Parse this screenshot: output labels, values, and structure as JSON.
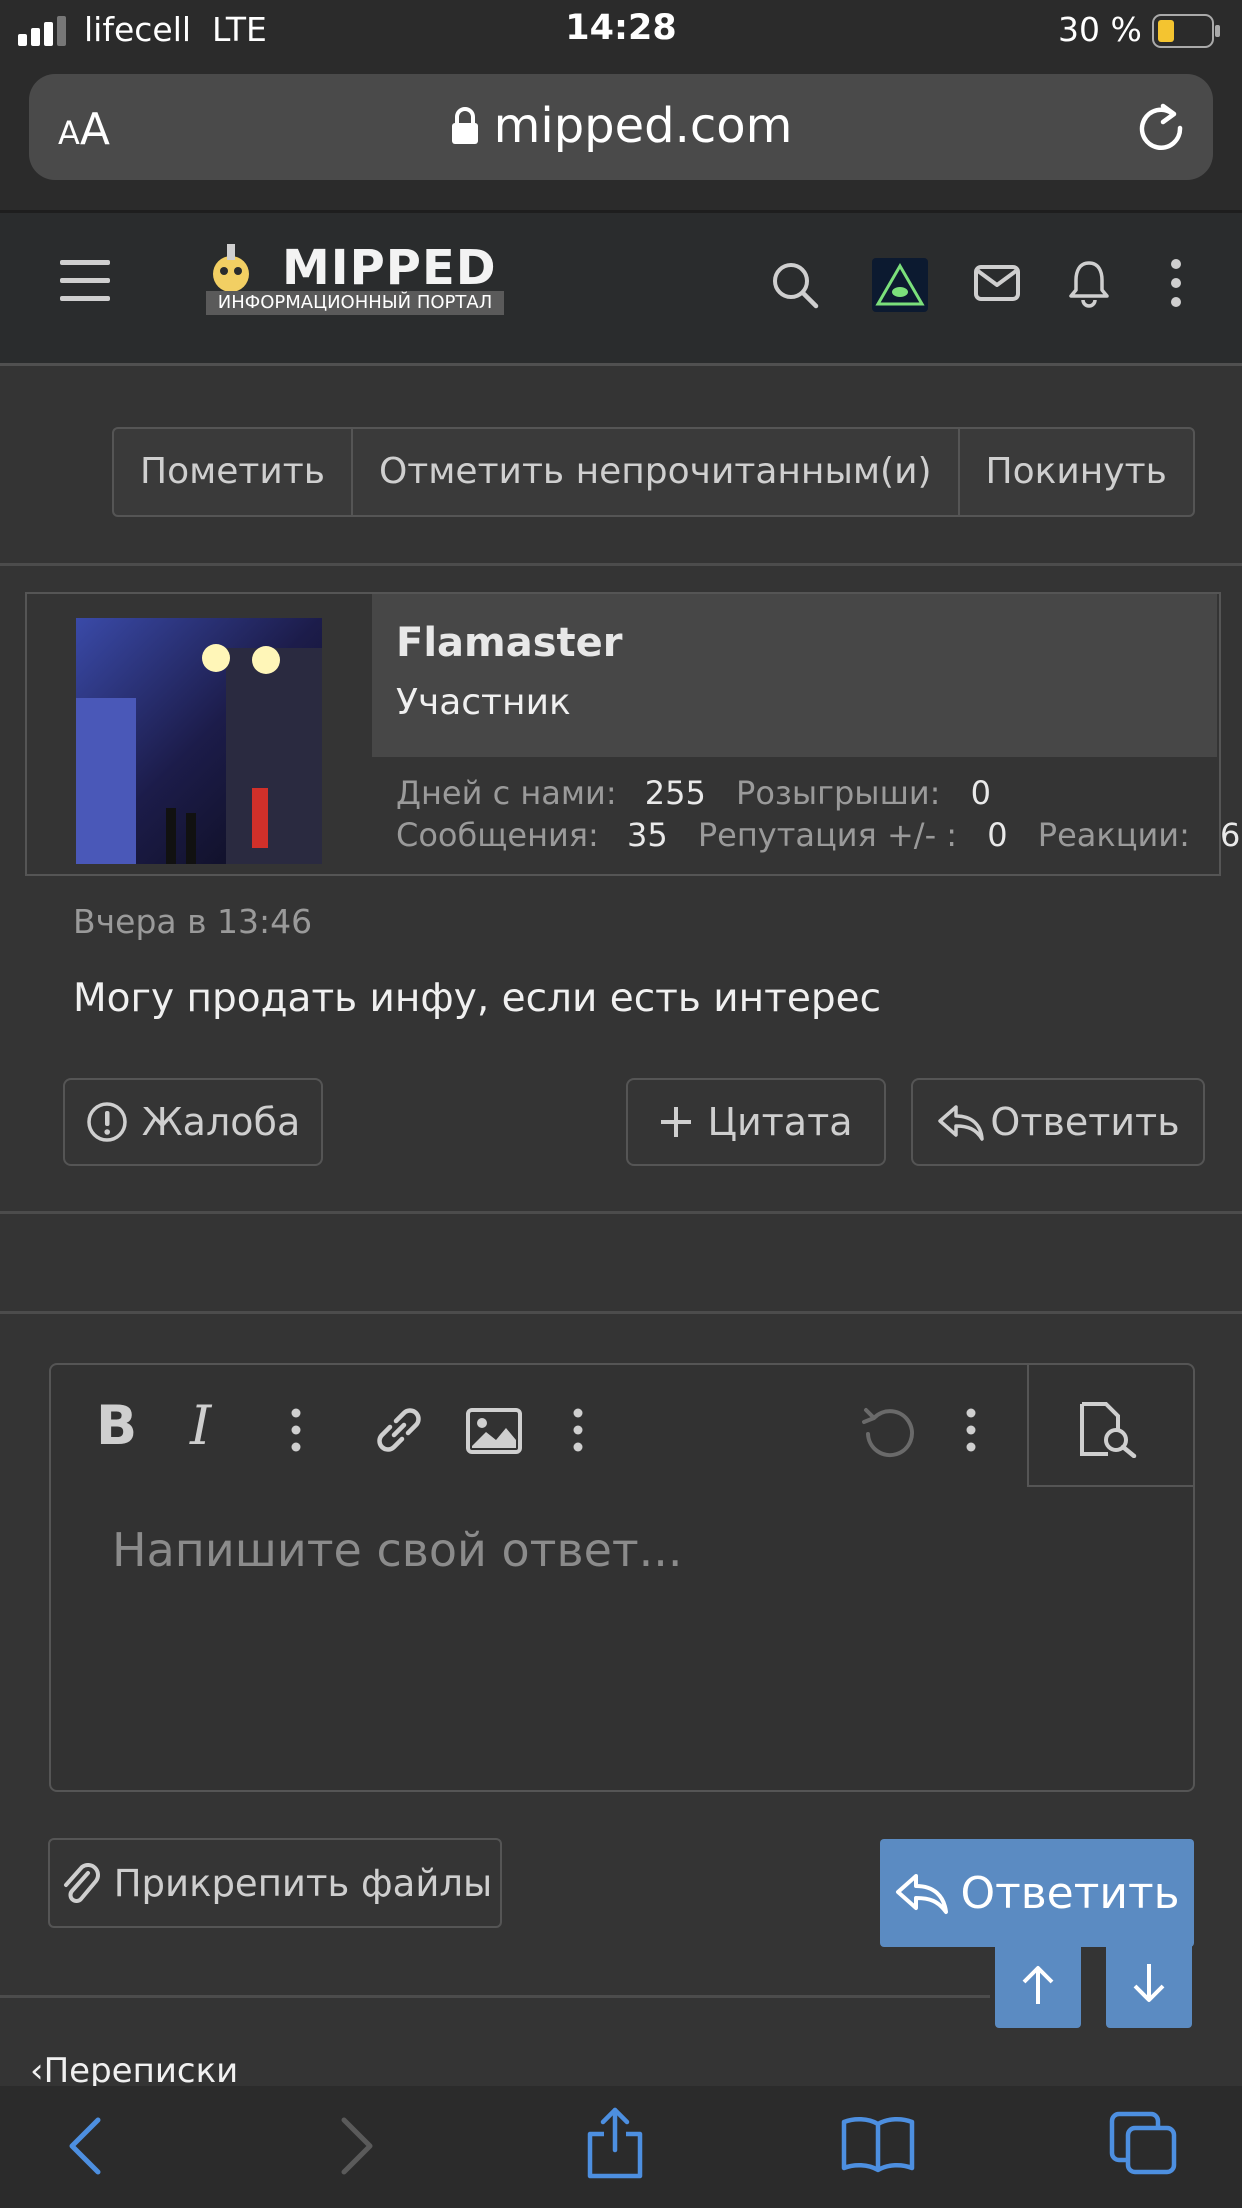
{
  "status": {
    "carrier": "lifecell  LTE",
    "time": "14:28",
    "battery": "30 %"
  },
  "browser": {
    "text_size": "AA",
    "url": "mipped.com"
  },
  "site": {
    "logo_title": "MIPPED",
    "logo_subtitle": "ИНФОРМАЦИОННЫЙ ПОРТАЛ"
  },
  "thread_actions": [
    "Пометить",
    "Отметить непрочитанным(и)",
    "Покинуть"
  ],
  "post": {
    "author": "Flamaster",
    "role": "Участник",
    "stats": {
      "days_label": "Дней с нами:",
      "days": "255",
      "giveaways_label": "Розыгрыши:",
      "giveaways": "0",
      "messages_label": "Сообщения:",
      "messages": "35",
      "reputation_label": "Репутация +/- :",
      "reputation": "0",
      "reactions_label": "Реакции:",
      "reactions": "6"
    },
    "timestamp": "Вчера в 13:46",
    "message": "Могу продать инфу, если есть интерес",
    "report": "Жалоба",
    "quote": "Цитата",
    "reply": "Ответить"
  },
  "editor": {
    "placeholder": "Напишите свой ответ..."
  },
  "attach_label": "Прикрепить файлы",
  "reply_button": "Ответить",
  "breadcrumb": "Переписки",
  "colors": {
    "accent": "#5b8bc2",
    "nav": "#4d8fe0",
    "background": "#343434"
  }
}
